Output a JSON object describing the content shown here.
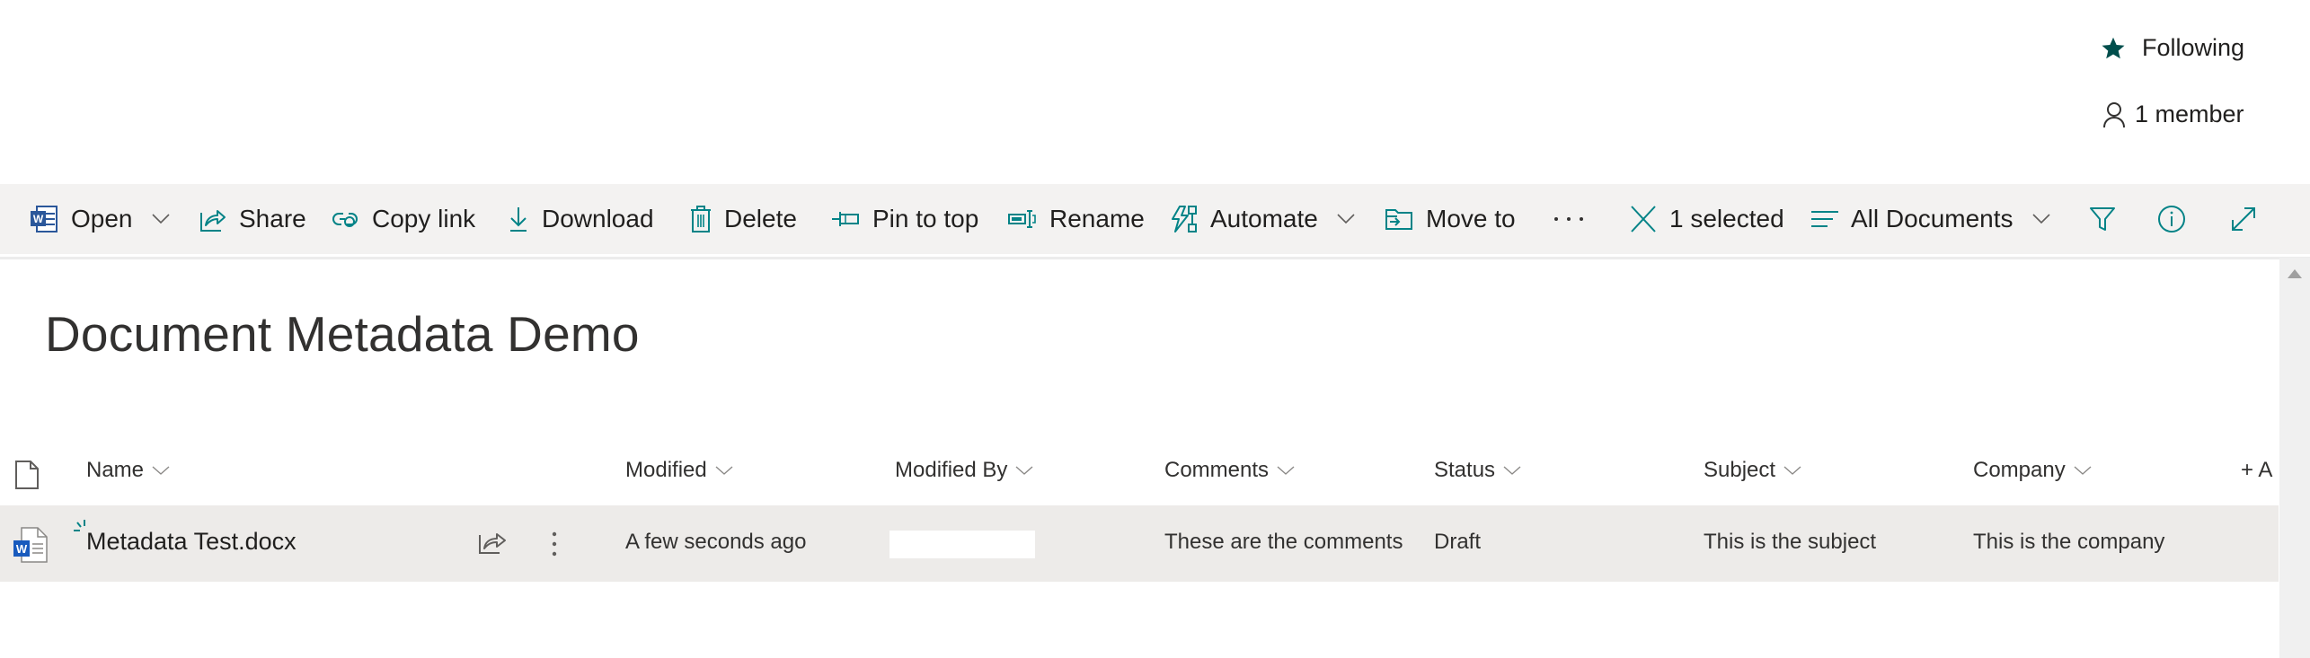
{
  "header": {
    "following_label": "Following",
    "members_label": "1 member",
    "star_color": "#004e4c"
  },
  "toolbar": {
    "items": [
      {
        "label": "Open",
        "icon": "word-icon",
        "dropdown": true
      },
      {
        "label": "Share",
        "icon": "share-icon"
      },
      {
        "label": "Copy link",
        "icon": "link-icon"
      },
      {
        "label": "Download",
        "icon": "download-icon"
      },
      {
        "label": "Delete",
        "icon": "trash-icon"
      },
      {
        "label": "Pin to top",
        "icon": "pin-icon"
      },
      {
        "label": "Rename",
        "icon": "rename-icon"
      },
      {
        "label": "Automate",
        "icon": "automate-icon",
        "dropdown": true
      },
      {
        "label": "Move to",
        "icon": "move-to-icon"
      },
      {
        "label": "...",
        "icon": "more-icon"
      }
    ],
    "selection_label": "1 selected",
    "view_label": "All Documents",
    "accent_color": "#038387"
  },
  "library": {
    "title": "Document Metadata Demo",
    "columns": [
      {
        "label": "Name"
      },
      {
        "label": "Modified"
      },
      {
        "label": "Modified By"
      },
      {
        "label": "Comments"
      },
      {
        "label": "Status"
      },
      {
        "label": "Subject"
      },
      {
        "label": "Company"
      }
    ],
    "add_column_label": "+ A",
    "rows": [
      {
        "name": "Metadata Test.docx",
        "modified": "A few seconds ago",
        "modified_by": "",
        "comments": "These are the comments",
        "status": "Draft",
        "subject": "This is the subject",
        "company": "This is the company"
      }
    ]
  }
}
